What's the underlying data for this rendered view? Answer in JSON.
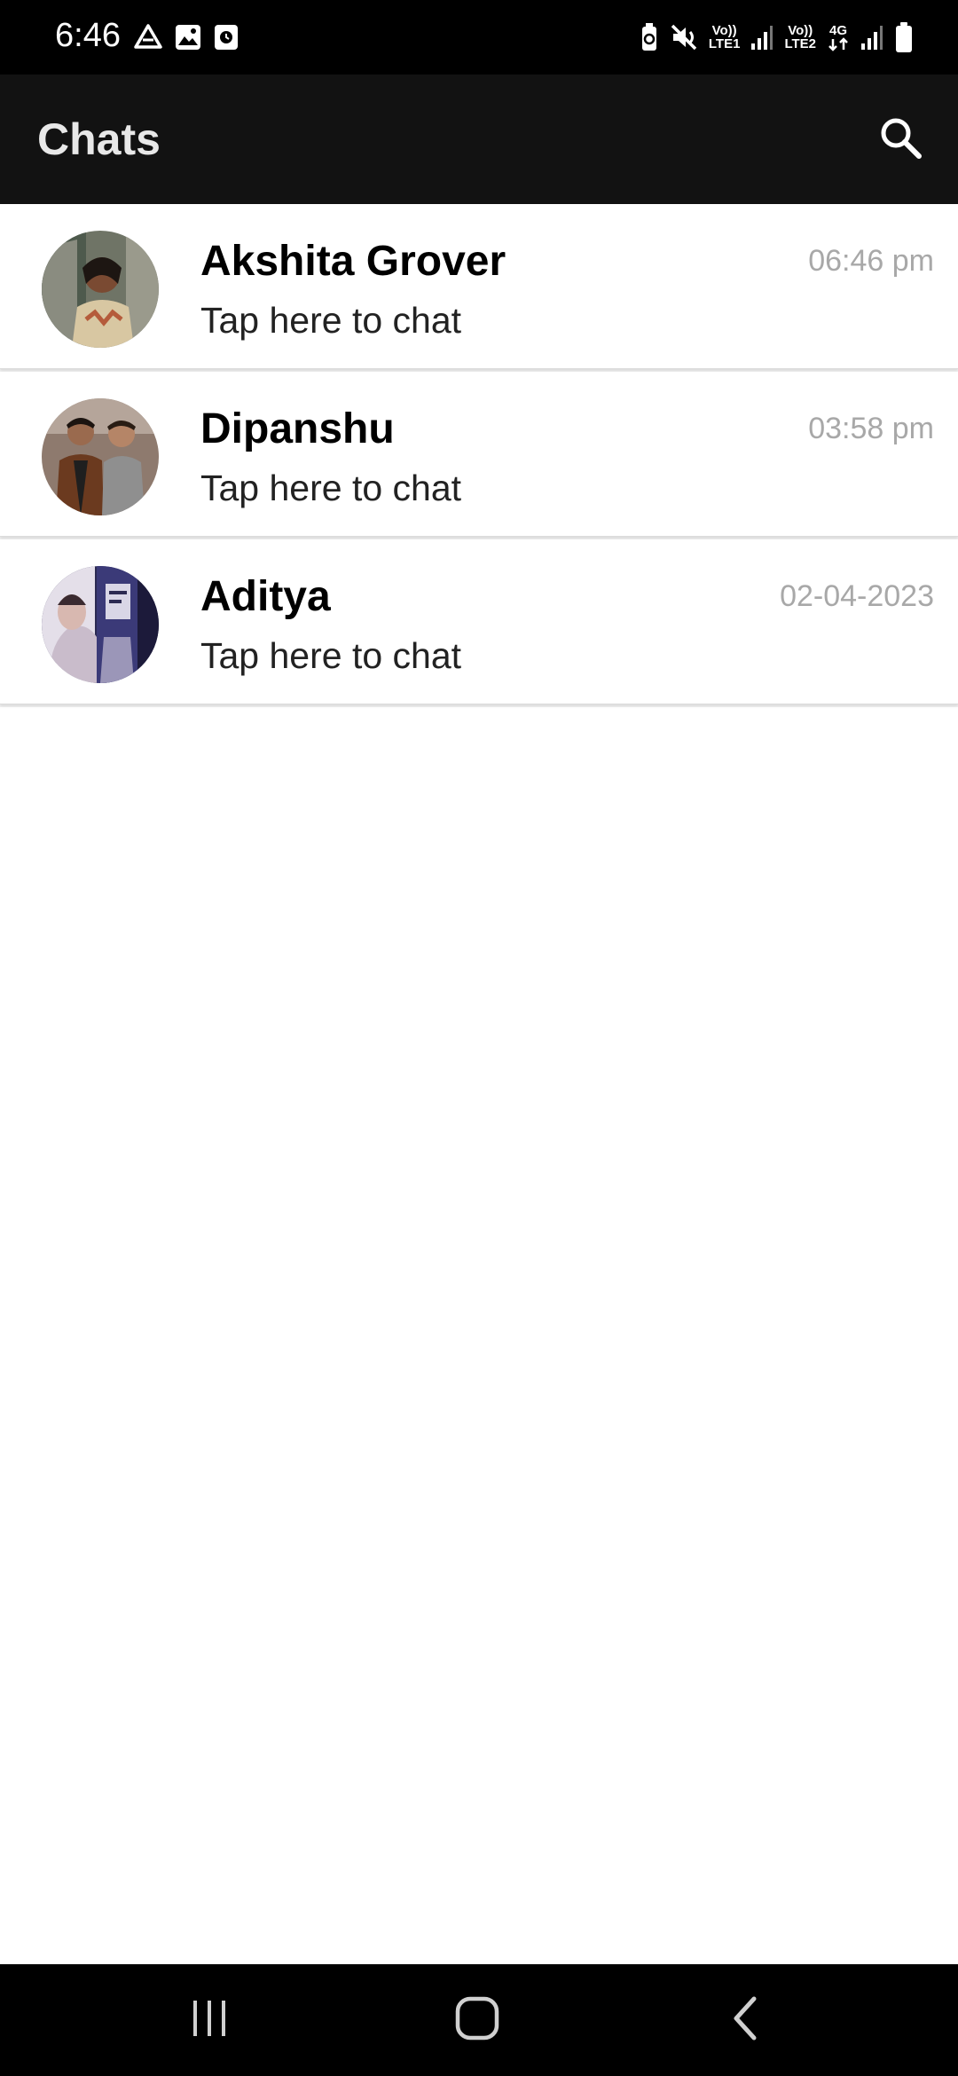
{
  "status_bar": {
    "time": "6:46",
    "left_icons": [
      "drive-icon",
      "gallery-icon",
      "clock-app-icon"
    ],
    "right_icons": [
      "battery-saver-icon",
      "mute-icon",
      "volte-lte1-icon",
      "signal-1-icon",
      "volte-lte2-icon",
      "data-4g-icon",
      "signal-2-icon",
      "battery-icon"
    ],
    "sim1_label_top": "Vo))",
    "sim1_label_bottom": "LTE1",
    "sim2_label_top": "Vo))",
    "sim2_label_bottom": "LTE2",
    "data_label": "4G"
  },
  "app_bar": {
    "title": "Chats",
    "search_icon": "search-icon",
    "background": "#121212"
  },
  "chats": [
    {
      "name": "Akshita Grover",
      "preview": "Tap here to chat",
      "time": "06:46 pm",
      "avatar": "avatar-photo"
    },
    {
      "name": "Dipanshu",
      "preview": "Tap here to chat",
      "time": "03:58 pm",
      "avatar": "avatar-photo"
    },
    {
      "name": "Aditya",
      "preview": "Tap here to chat",
      "time": "02-04-2023",
      "avatar": "avatar-photo"
    }
  ],
  "nav_bar": {
    "buttons": [
      "recents-icon",
      "home-icon",
      "back-icon"
    ]
  },
  "colors": {
    "status_bar": "#000000",
    "app_bar": "#121212",
    "title_text": "#e8e8e8",
    "time_text": "#a8a8a8",
    "list_background": "#ffffff"
  }
}
